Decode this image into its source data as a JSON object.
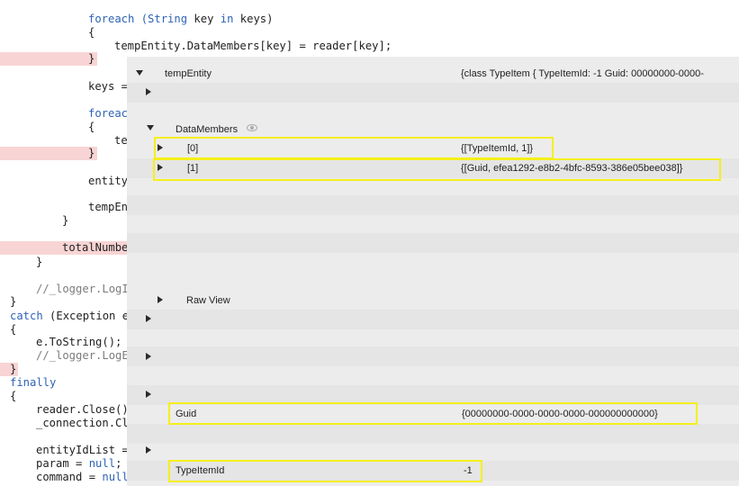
{
  "code": {
    "l01": {
      "a": "foreach (",
      "b": "String",
      "c": " key ",
      "d": "in",
      "e": " keys)"
    },
    "l02": "{",
    "l03": "tempEntity.DataMembers[key] = reader[key];",
    "l04": "}",
    "l05": "keys =",
    "l06": "foreac",
    "l07": "{",
    "l08": "te",
    "l09": "}",
    "l10": "entity",
    "l11": "tempEn",
    "l12": "}",
    "l13": "totalNumbe",
    "l14": "}",
    "l15": "//_logger.LogI",
    "l16": "}",
    "l17": {
      "a": "catch",
      "b": " (Exception e"
    },
    "l18": "{",
    "l19": "e.ToString();",
    "l20": "//_logger.LogE",
    "l21": "}",
    "l22": "finally",
    "l23": "{",
    "l24": "reader.Close()",
    "l25": "_connection.Cl",
    "l26": "entityIdList =",
    "l27": {
      "a": "param = ",
      "b": "null",
      "c": ";"
    },
    "l28": {
      "a": "command = ",
      "b": "null"
    }
  },
  "debugger": {
    "root_name": "tempEntity",
    "root_value": "{class TypeItem {  TypeItemId: -1  Guid: 00000000-0000-",
    "datamembers_name": "DataMembers",
    "item0_name": "[0]",
    "item0_value": "{[TypeItemId, 1]}",
    "item1_name": "[1]",
    "item1_value": "{[Guid, efea1292-e8b2-4bfc-8593-386e05bee038]}",
    "rawview_name": "Raw View",
    "guid_name": "Guid",
    "guid_value": "{00000000-0000-0000-0000-000000000000}",
    "typeitemid_name": "TypeItemId",
    "typeitemid_value": "-1"
  },
  "colors": {
    "breakpoint_row": "#f8d4d4",
    "keyword": "#2f63b6",
    "highlight_box": "#f5ef1a"
  }
}
